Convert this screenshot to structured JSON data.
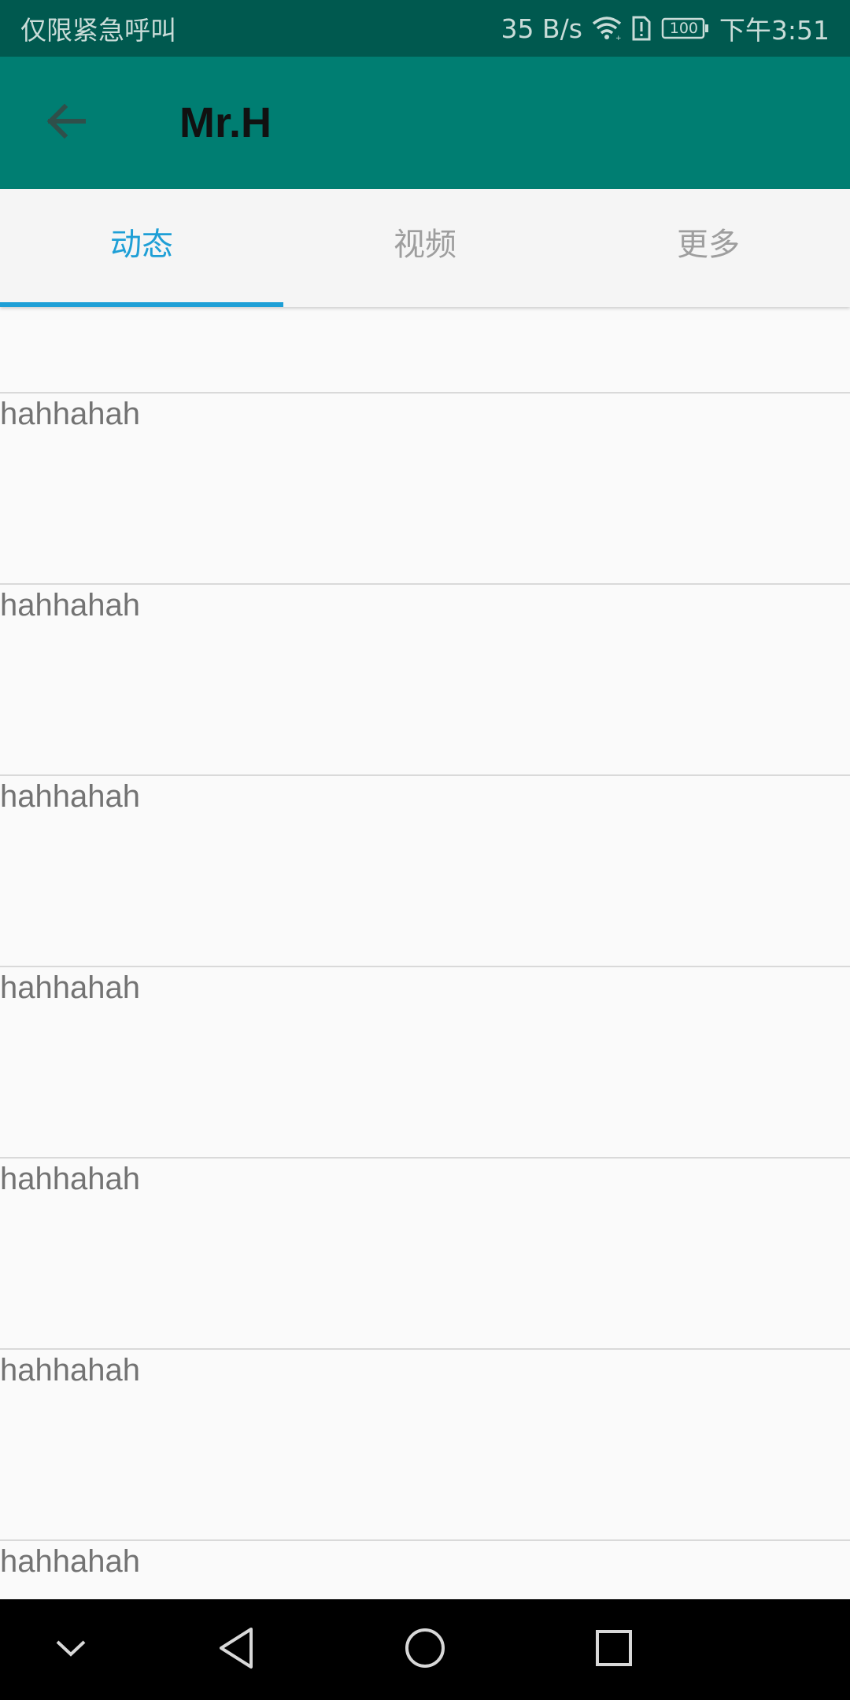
{
  "status_bar": {
    "carrier": "仅限紧急呼叫",
    "net_speed": "35 B/s",
    "battery_level": "100",
    "time": "下午3:51",
    "icons": [
      "wifi-icon",
      "sim-alert-icon",
      "battery-icon"
    ]
  },
  "app_bar": {
    "title": "Mr.H",
    "back_icon": "arrow-left-icon",
    "background": "#007e72"
  },
  "tabs": [
    {
      "label": "动态",
      "active": true
    },
    {
      "label": "视频",
      "active": false
    },
    {
      "label": "更多",
      "active": false
    }
  ],
  "accent_color": "#1e9fd6",
  "list": {
    "items": [
      {
        "text": "hahhahah"
      },
      {
        "text": "hahhahah"
      },
      {
        "text": "hahhahah"
      },
      {
        "text": "hahhahah"
      },
      {
        "text": "hahhahah"
      },
      {
        "text": "hahhahah"
      },
      {
        "text": "hahhahah"
      }
    ]
  },
  "nav_bar": {
    "buttons": [
      "chevron-down-icon",
      "back-triangle-icon",
      "home-circle-icon",
      "recents-square-icon"
    ]
  }
}
